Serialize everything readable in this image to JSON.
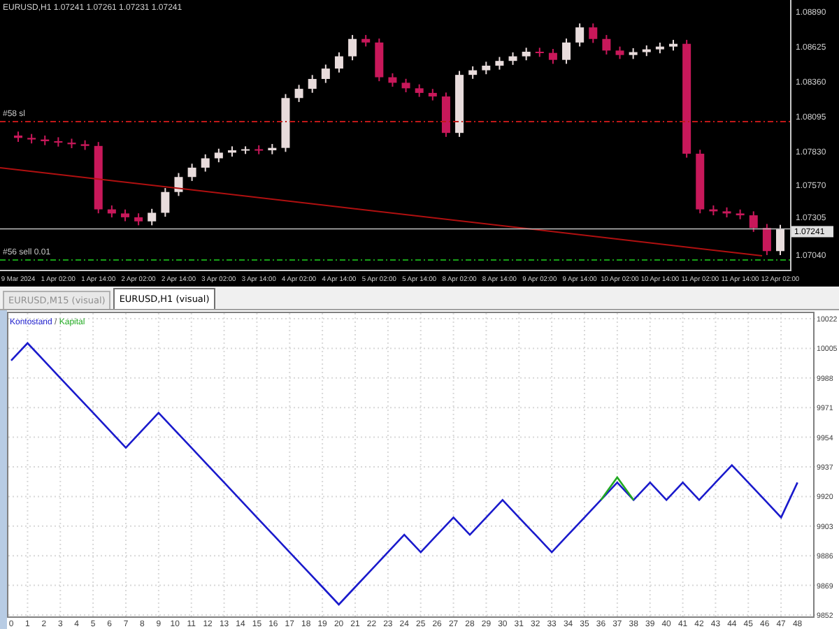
{
  "chart": {
    "title": "EURUSD,H1",
    "ohlc": [
      "1.07241",
      "1.07261",
      "1.07231",
      "1.07241"
    ],
    "current_price": "1.07241",
    "order_lines": [
      {
        "label": "#58 sl",
        "kind": "stop"
      },
      {
        "label": "#56 sell 0.01",
        "kind": "entry"
      }
    ],
    "chart_data": {
      "type": "candlestick",
      "categories": [
        "9 Mar 2024",
        null,
        null,
        "1 Apr 02:00",
        null,
        null,
        "1 Apr 14:00",
        null,
        null,
        "2 Apr 02:00",
        null,
        null,
        "2 Apr 14:00",
        null,
        null,
        "3 Apr 02:00",
        null,
        null,
        "3 Apr 14:00",
        null,
        null,
        "4 Apr 02:00",
        null,
        null,
        "4 Apr 14:00",
        null,
        null,
        "5 Apr 02:00",
        null,
        null,
        "5 Apr 14:00",
        null,
        null,
        "8 Apr 02:00",
        null,
        null,
        "8 Apr 14:00",
        null,
        null,
        "9 Apr 02:00",
        null,
        null,
        "9 Apr 14:00",
        null,
        null,
        "10 Apr 02:00",
        null,
        null,
        "10 Apr 14:00",
        null,
        null,
        "11 Apr 02:00",
        null,
        null,
        "11 Apr 14:00",
        null,
        null,
        "12 Apr 02:00"
      ],
      "ohlc": [
        [
          1.0795,
          1.0798,
          1.07902,
          1.07932
        ],
        [
          1.07932,
          1.07962,
          1.0789,
          1.0792
        ],
        [
          1.0792,
          1.0795,
          1.07877,
          1.07907
        ],
        [
          1.07907,
          1.07937,
          1.07866,
          1.07896
        ],
        [
          1.07896,
          1.07926,
          1.07854,
          1.07884
        ],
        [
          1.07884,
          1.07914,
          1.07841,
          1.07871
        ],
        [
          1.07871,
          1.07901,
          1.07359,
          1.07389
        ],
        [
          1.07389,
          1.07419,
          1.07328,
          1.07358
        ],
        [
          1.07358,
          1.07388,
          1.07299,
          1.07329
        ],
        [
          1.07329,
          1.07359,
          1.07268,
          1.07298
        ],
        [
          1.07298,
          1.07393,
          1.07268,
          1.07363
        ],
        [
          1.07363,
          1.07551,
          1.07333,
          1.07521
        ],
        [
          1.07521,
          1.07665,
          1.07491,
          1.07635
        ],
        [
          1.07635,
          1.07736,
          1.07605,
          1.07706
        ],
        [
          1.07706,
          1.07807,
          1.07676,
          1.07777
        ],
        [
          1.07777,
          1.0785,
          1.07747,
          1.0782
        ],
        [
          1.0782,
          1.07868,
          1.0779,
          1.07838
        ],
        [
          1.07838,
          1.07868,
          1.0781,
          1.07846
        ],
        [
          1.07846,
          1.07876,
          1.07808,
          1.07838
        ],
        [
          1.07838,
          1.07886,
          1.07808,
          1.07856
        ],
        [
          1.07856,
          1.08265,
          1.07826,
          1.08235
        ],
        [
          1.08235,
          1.08335,
          1.08205,
          1.08305
        ],
        [
          1.08305,
          1.0841,
          1.08275,
          1.0838
        ],
        [
          1.0838,
          1.08489,
          1.0835,
          1.08459
        ],
        [
          1.08459,
          1.08582,
          1.08429,
          1.08552
        ],
        [
          1.08552,
          1.08714,
          1.08522,
          1.08684
        ],
        [
          1.08684,
          1.08714,
          1.08627,
          1.08657
        ],
        [
          1.08657,
          1.08687,
          1.08363,
          1.08393
        ],
        [
          1.08393,
          1.08423,
          1.08321,
          1.08351
        ],
        [
          1.08351,
          1.08381,
          1.08279,
          1.08309
        ],
        [
          1.08309,
          1.08339,
          1.08244,
          1.08274
        ],
        [
          1.08274,
          1.08304,
          1.08217,
          1.08247
        ],
        [
          1.08247,
          1.08277,
          1.0794,
          1.0797
        ],
        [
          1.0797,
          1.08441,
          1.0794,
          1.08411
        ],
        [
          1.08411,
          1.08476,
          1.08381,
          1.08446
        ],
        [
          1.08446,
          1.08511,
          1.08416,
          1.08481
        ],
        [
          1.08481,
          1.08547,
          1.08451,
          1.08517
        ],
        [
          1.08517,
          1.08582,
          1.08487,
          1.08552
        ],
        [
          1.08552,
          1.08617,
          1.08522,
          1.08587
        ],
        [
          1.08587,
          1.08617,
          1.08548,
          1.08578
        ],
        [
          1.08578,
          1.08608,
          1.08495,
          1.08525
        ],
        [
          1.08525,
          1.08687,
          1.08495,
          1.08657
        ],
        [
          1.08657,
          1.08802,
          1.08627,
          1.08772
        ],
        [
          1.08772,
          1.08802,
          1.08654,
          1.08684
        ],
        [
          1.08684,
          1.08714,
          1.08566,
          1.08596
        ],
        [
          1.08596,
          1.08626,
          1.08532,
          1.08562
        ],
        [
          1.08562,
          1.08614,
          1.08532,
          1.08584
        ],
        [
          1.08584,
          1.08635,
          1.08554,
          1.08605
        ],
        [
          1.08605,
          1.08656,
          1.08575,
          1.08626
        ],
        [
          1.08626,
          1.08677,
          1.08596,
          1.08647
        ],
        [
          1.08647,
          1.08677,
          1.07782,
          1.07812
        ],
        [
          1.07812,
          1.07842,
          1.07359,
          1.07389
        ],
        [
          1.07389,
          1.07419,
          1.07344,
          1.07374
        ],
        [
          1.07374,
          1.07404,
          1.07328,
          1.07358
        ],
        [
          1.07358,
          1.07388,
          1.07314,
          1.07344
        ],
        [
          1.07344,
          1.07374,
          1.07218,
          1.07248
        ],
        [
          1.07248,
          1.07278,
          1.07042,
          1.07072
        ],
        [
          1.07072,
          1.07271,
          1.07042,
          1.07241
        ]
      ],
      "ylim": [
        1.0693,
        1.0898
      ],
      "yticks": [
        {
          "value": 1.0889,
          "label": "1.08890"
        },
        {
          "value": 1.08625,
          "label": "1.08625"
        },
        {
          "value": 1.0836,
          "label": "1.08360"
        },
        {
          "value": 1.08095,
          "label": "1.08095"
        },
        {
          "value": 1.0783,
          "label": "1.07830"
        },
        {
          "value": 1.0757,
          "label": "1.07570"
        },
        {
          "value": 1.07305,
          "label": "1.07305"
        },
        {
          "value": 1.0704,
          "label": "1.07040"
        }
      ]
    }
  },
  "tabs": [
    {
      "label": "EURUSD,M15 (visual)",
      "selected": false
    },
    {
      "label": "EURUSD,H1 (visual)",
      "selected": true
    }
  ],
  "report": {
    "legend_separator": "/",
    "chart_data": {
      "type": "line",
      "grid": true,
      "x": [
        0,
        1,
        2,
        3,
        4,
        5,
        6,
        7,
        8,
        9,
        10,
        11,
        12,
        13,
        14,
        15,
        16,
        17,
        18,
        19,
        20,
        21,
        22,
        23,
        24,
        25,
        26,
        27,
        28,
        29,
        30,
        31,
        32,
        33,
        34,
        35,
        36,
        37,
        38,
        39,
        40,
        41,
        42,
        43,
        44,
        45,
        46,
        47,
        48
      ],
      "series": [
        {
          "name": "Kontostand",
          "color": "#1a1acc",
          "values": [
            9998,
            10008,
            9998,
            9988,
            9978,
            9968,
            9958,
            9948,
            9958,
            9968,
            9958,
            9948,
            9938,
            9928,
            9918,
            9908,
            9898,
            9888,
            9878,
            9868,
            9858,
            9868,
            9878,
            9888,
            9898,
            9888,
            9898,
            9908,
            9898,
            9908,
            9918,
            9908,
            9898,
            9888,
            9898,
            9908,
            9918,
            9928,
            9918,
            9928,
            9918,
            9928,
            9918,
            9928,
            9938,
            9928,
            9918,
            9908,
            9928
          ]
        },
        {
          "name": "Kapital",
          "color": "#22aa22",
          "values": [
            null,
            null,
            null,
            null,
            null,
            null,
            null,
            null,
            null,
            null,
            null,
            null,
            null,
            null,
            null,
            null,
            null,
            null,
            null,
            null,
            null,
            null,
            null,
            null,
            null,
            null,
            null,
            null,
            null,
            null,
            null,
            null,
            null,
            null,
            null,
            null,
            9918,
            9931,
            9918,
            null,
            null,
            null,
            null,
            null,
            null,
            null,
            null,
            null,
            null
          ]
        }
      ],
      "xlim": [
        0,
        49
      ],
      "ylim": [
        9852,
        10022
      ],
      "xticks": [
        0,
        1,
        2,
        3,
        4,
        5,
        6,
        7,
        8,
        9,
        10,
        11,
        12,
        13,
        14,
        15,
        16,
        17,
        18,
        19,
        20,
        21,
        22,
        23,
        24,
        25,
        26,
        27,
        28,
        29,
        30,
        31,
        32,
        33,
        34,
        35,
        36,
        37,
        38,
        39,
        40,
        41,
        42,
        43,
        44,
        45,
        46,
        47,
        48
      ],
      "yticks": [
        9852,
        9869,
        9886,
        9903,
        9920,
        9937,
        9954,
        9971,
        9988,
        10005,
        10022
      ]
    }
  }
}
